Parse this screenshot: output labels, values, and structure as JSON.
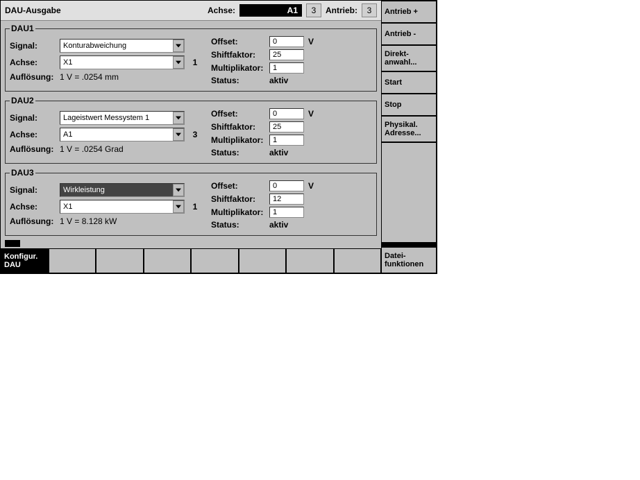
{
  "header": {
    "title": "DAU-Ausgabe",
    "achse_label": "Achse:",
    "achse_value": "A1",
    "achse_num": "3",
    "antrieb_label": "Antrieb:",
    "antrieb_num": "3"
  },
  "labels": {
    "signal": "Signal:",
    "achse": "Achse:",
    "aufloesung": "Auflösung:",
    "offset": "Offset:",
    "shiftfaktor": "Shiftfaktor:",
    "multiplikator": "Multiplikator:",
    "status": "Status:",
    "v_unit": "V"
  },
  "dau": [
    {
      "legend": "DAU1",
      "signal": "Konturabweichung",
      "achse": "X1",
      "achse_num": "1",
      "aufloesung": "1 V =  .0254 mm",
      "offset": "0",
      "shiftfaktor": "25",
      "multiplikator": "1",
      "status": "aktiv"
    },
    {
      "legend": "DAU2",
      "signal": "Lageistwert Messystem 1",
      "achse": "A1",
      "achse_num": "3",
      "aufloesung": "1 V =  .0254 Grad",
      "offset": "0",
      "shiftfaktor": "25",
      "multiplikator": "1",
      "status": "aktiv"
    },
    {
      "legend": "DAU3",
      "signal": "Wirkleistung",
      "achse": "X1",
      "achse_num": "1",
      "aufloesung": "1 V =  8.128 kW",
      "offset": "0",
      "shiftfaktor": "12",
      "multiplikator": "1",
      "status": "aktiv"
    }
  ],
  "bottombar": {
    "konfigur": "Konfigur. DAU"
  },
  "sidebar": {
    "antrieb_plus": "Antrieb +",
    "antrieb_minus": "Antrieb -",
    "direkt": "Direkt-anwahl...",
    "start": "Start",
    "stop": "Stop",
    "physikal": "Physikal. Adresse...",
    "datei": "Datei-funktionen"
  }
}
